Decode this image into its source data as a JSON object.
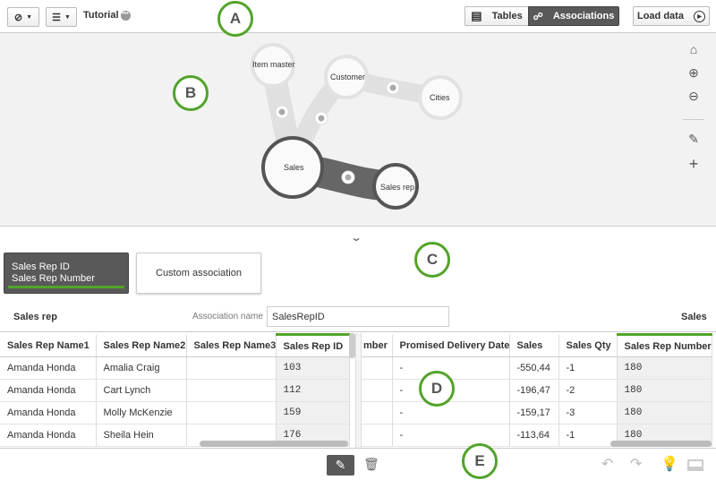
{
  "topbar": {
    "app_title": "Tutorial",
    "tables_label": "Tables",
    "associations_label": "Associations",
    "load_data_label": "Load data"
  },
  "graph": {
    "nodes": [
      "Item master",
      "Customer",
      "Cities",
      "Sales",
      "Sales rep"
    ]
  },
  "association": {
    "card_field1": "Sales Rep ID",
    "card_field2": "Sales Rep Number",
    "custom_label": "Custom association",
    "left_table": "Sales rep",
    "right_table": "Sales",
    "name_label": "Association name",
    "name_value": "SalesRepID"
  },
  "left_table": {
    "headers": [
      "Sales Rep Name1",
      "Sales Rep Name2",
      "Sales Rep Name3",
      "Sales Rep ID"
    ],
    "rows": [
      [
        "Amanda Honda",
        "Amalia Craig",
        "",
        "103"
      ],
      [
        "Amanda Honda",
        "Cart Lynch",
        "",
        "112"
      ],
      [
        "Amanda Honda",
        "Molly McKenzie",
        "",
        "159"
      ],
      [
        "Amanda Honda",
        "Sheila Hein",
        "",
        "176"
      ]
    ]
  },
  "right_table": {
    "headers": [
      "mber",
      "Promised Delivery Date",
      "Sales",
      "Sales Qty",
      "Sales Rep Number"
    ],
    "rows": [
      [
        "",
        "-",
        "-550,44",
        "-1",
        "180"
      ],
      [
        "",
        "-",
        "-196,47",
        "-2",
        "180"
      ],
      [
        "",
        "-",
        "-159,17",
        "-3",
        "180"
      ],
      [
        "",
        "-",
        "-113,64",
        "-1",
        "180"
      ]
    ]
  },
  "annotations": [
    "A",
    "B",
    "C",
    "D",
    "E"
  ],
  "colors": {
    "accent": "#52a32a",
    "dark": "#595959"
  }
}
